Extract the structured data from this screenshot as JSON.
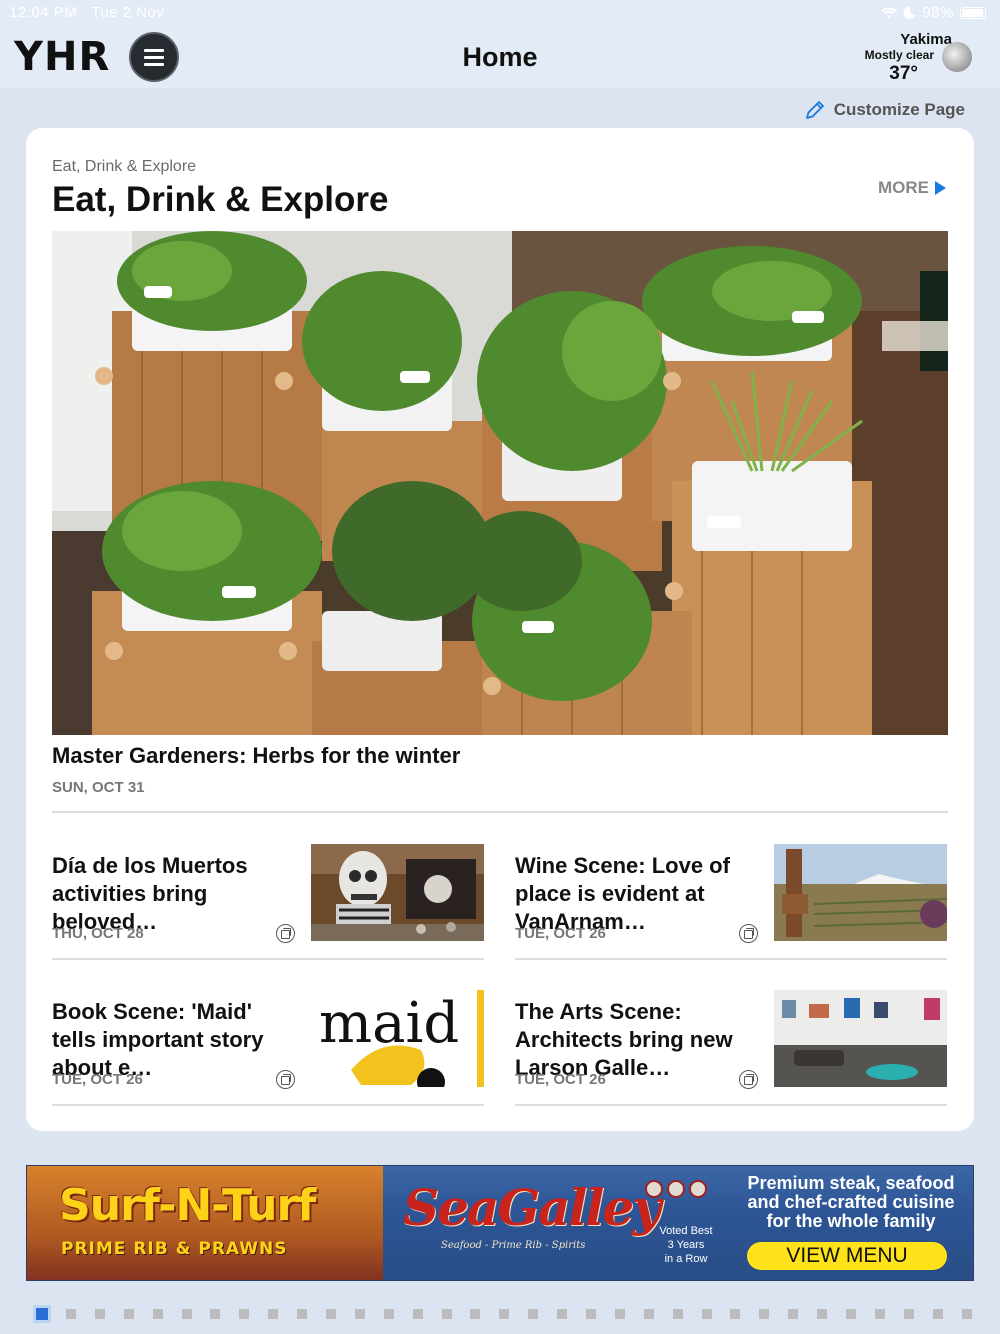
{
  "status_bar": {
    "time": "12:04 PM",
    "date": "Tue 2 Nov",
    "battery": "98%"
  },
  "header": {
    "logo": "YHR",
    "title": "Home",
    "weather": {
      "city": "Yakima",
      "condition": "Mostly clear",
      "temperature": "37°",
      "icon": "moon-icon"
    }
  },
  "customize_label": "Customize Page",
  "section": {
    "kicker": "Eat, Drink & Explore",
    "title": "Eat, Drink & Explore",
    "more_label": "MORE",
    "hero": {
      "title": "Master Gardeners: Herbs for the winter",
      "date": "SUN, OCT 31"
    },
    "stories": [
      {
        "title": "Día de los Muertos activities bring beloved…",
        "date": "THU, OCT 28"
      },
      {
        "title": "Wine Scene: Love of place is evident at VanArnam…",
        "date": "TUE, OCT 26"
      },
      {
        "title": "Book Scene: 'Maid' tells important story about e…",
        "date": "TUE, OCT 26"
      },
      {
        "title": "The Arts Scene: Architects bring new Larson Galle…",
        "date": "TUE, OCT 26"
      }
    ]
  },
  "ad": {
    "surf": "Surf-N-Turf",
    "prime": "PRIME RIB & PRAWNS",
    "brand": "SeaGalley",
    "brand_sub": "Seafood - Prime Rib - Spirits",
    "voted": [
      "Voted Best",
      "3 Years",
      "in a Row"
    ],
    "copy": "Premium steak, seafood and chef-crafted cuisine for the whole family",
    "button": "VIEW MENU",
    "maid_text": "maid"
  },
  "pager": {
    "total": 33,
    "active": 1
  }
}
